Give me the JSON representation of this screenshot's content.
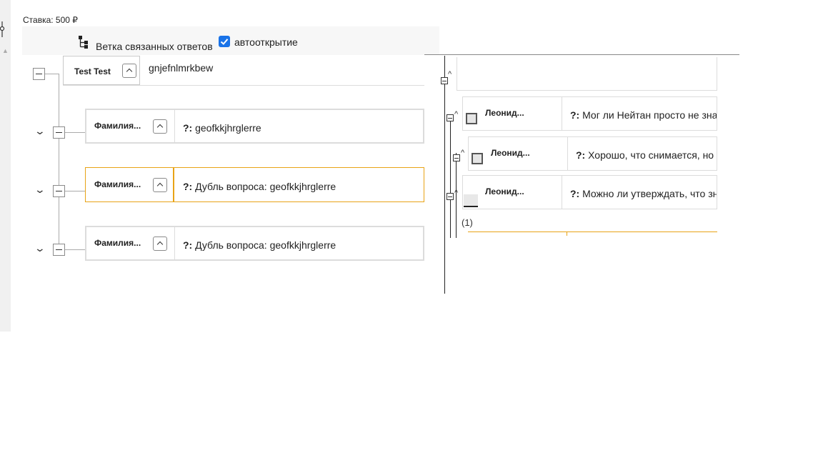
{
  "header": {
    "stake": "Ставка: 500 ₽"
  },
  "toolbar": {
    "branch_label": "Ветка связанных ответов",
    "auto_label": "автооткрытие",
    "auto_checked": true
  },
  "root": {
    "name": "Test Test",
    "text": "gnjefnlmrkbew"
  },
  "cards": [
    {
      "name": "Фамилия...",
      "q_prefix": "?:",
      "q_text": "geofkkjhrglerre"
    },
    {
      "name": "Фамилия...",
      "q_prefix": "?:",
      "q_text": "Дубль вопроса: geofkkjhrglerre"
    },
    {
      "name": "Фамилия...",
      "q_prefix": "?:",
      "q_text": "Дубль вопроса: geofkkjhrglerre"
    }
  ],
  "right_cards": [
    {
      "name": "Леонид...",
      "q_prefix": "?:",
      "q_text": "Мог ли Нейтан просто не зна"
    },
    {
      "name": "Леонид...",
      "q_prefix": "?:",
      "q_text": "Хорошо, что снимается, но"
    },
    {
      "name": "Леонид...",
      "q_prefix": "?:",
      "q_text": "Можно ли утверждать, что зн"
    }
  ],
  "right_count": "(1)",
  "colors": {
    "highlight": "#e8a317",
    "checkbox": "#1a73e8"
  }
}
